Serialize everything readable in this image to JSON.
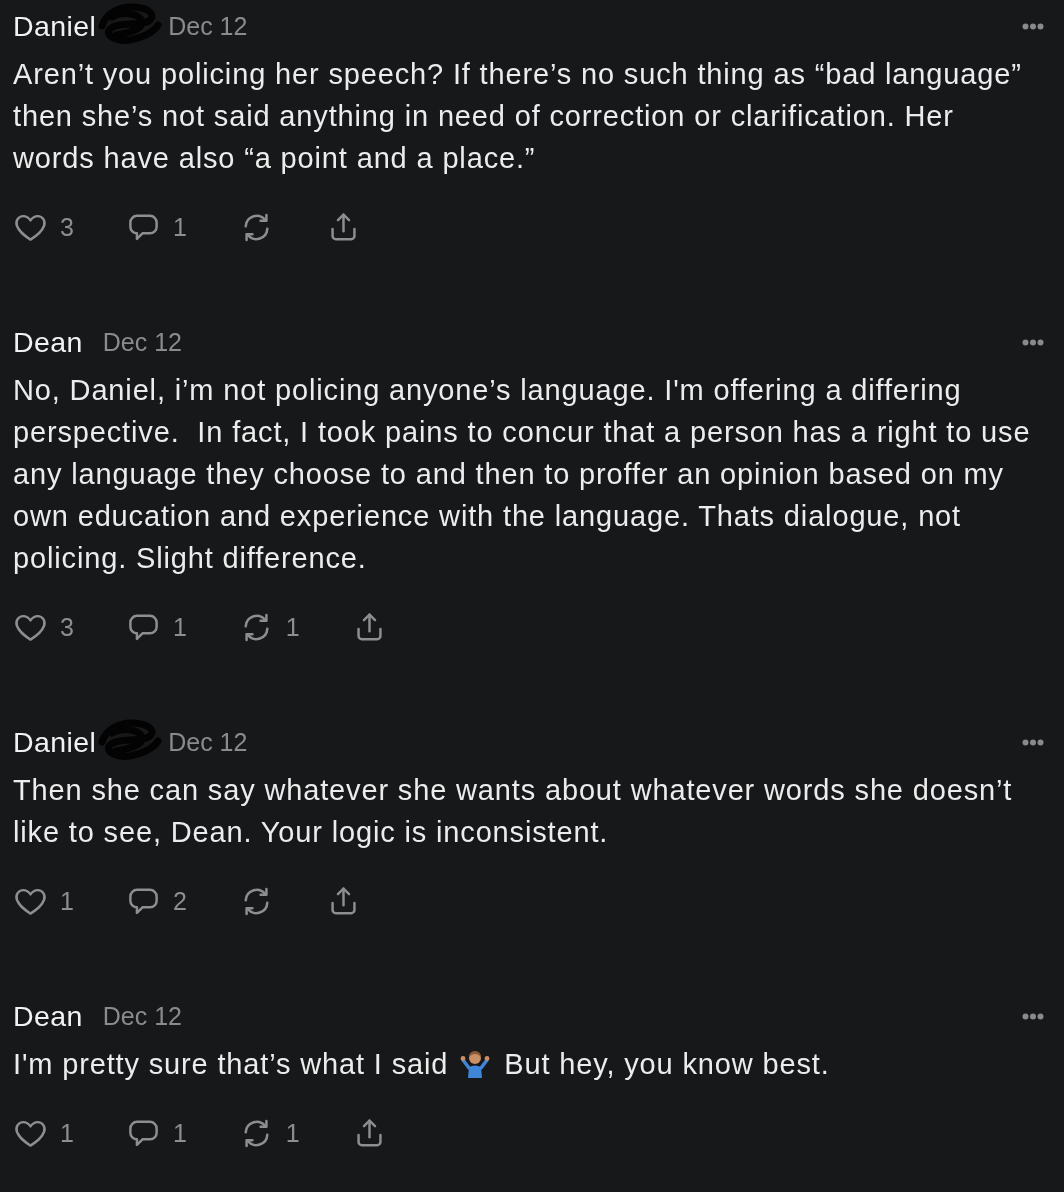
{
  "comments": [
    {
      "author": "Daniel",
      "redacted": true,
      "date": "Dec 12",
      "body": [
        {
          "kind": "text",
          "text": "Aren’t you policing her speech? If there’s no such thing as “bad language” then she’s not said anything in need of correction or clarification. Her words have also “a point and a place.”"
        }
      ],
      "actions": [
        {
          "kind": "like",
          "count": "3"
        },
        {
          "kind": "reply",
          "count": "1"
        },
        {
          "kind": "restack"
        },
        {
          "kind": "share"
        }
      ]
    },
    {
      "author": "Dean",
      "redacted": false,
      "date": "Dec 12",
      "body": [
        {
          "kind": "text",
          "text": "No, Daniel, i’m not policing anyone’s language. I'm offering a differing perspective.  In fact, I took pains to concur that a person has a right to use any language they choose to and then to proffer an opinion based on my own education and experience with the language. Thats dialogue, not policing. Slight difference."
        }
      ],
      "actions": [
        {
          "kind": "like",
          "count": "3"
        },
        {
          "kind": "reply",
          "count": "1"
        },
        {
          "kind": "restack",
          "count": "1"
        },
        {
          "kind": "share"
        }
      ]
    },
    {
      "author": "Daniel",
      "redacted": true,
      "date": "Dec 12",
      "body": [
        {
          "kind": "text",
          "text": "Then she can say whatever she wants about whatever words she doesn’t like to see, Dean. Your logic is inconsistent."
        }
      ],
      "actions": [
        {
          "kind": "like",
          "count": "1"
        },
        {
          "kind": "reply",
          "count": "2"
        },
        {
          "kind": "restack"
        },
        {
          "kind": "share"
        }
      ]
    },
    {
      "author": "Dean",
      "redacted": false,
      "date": "Dec 12",
      "body": [
        {
          "kind": "text",
          "text": "I'm pretty sure that’s what I said"
        },
        {
          "kind": "emoji"
        },
        {
          "kind": "text",
          "text": "But hey, you know best."
        }
      ],
      "actions": [
        {
          "kind": "like",
          "count": "1"
        },
        {
          "kind": "reply",
          "count": "1"
        },
        {
          "kind": "restack",
          "count": "1"
        },
        {
          "kind": "share"
        }
      ]
    }
  ]
}
